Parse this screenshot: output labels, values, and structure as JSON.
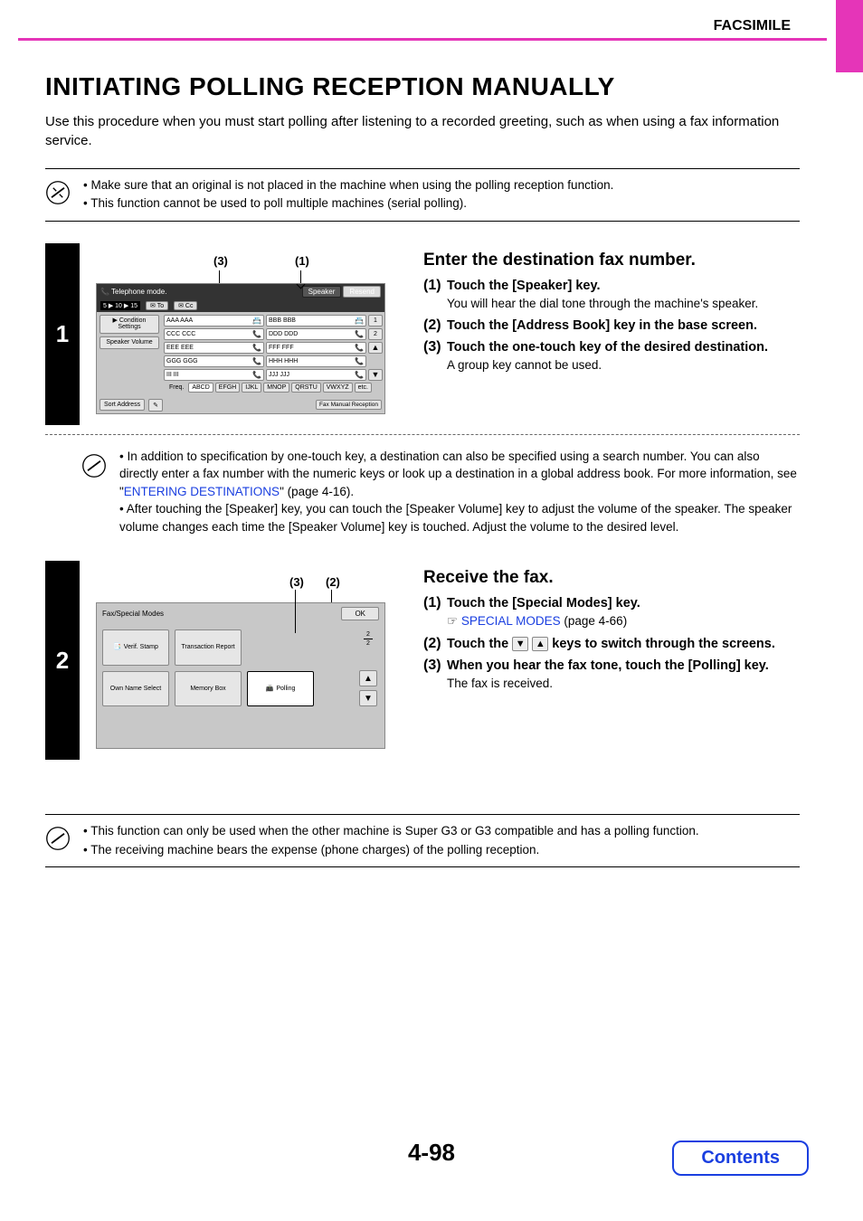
{
  "header": {
    "category": "FACSIMILE"
  },
  "title": "INITIATING POLLING RECEPTION MANUALLY",
  "intro": "Use this procedure when you must start polling after listening to a recorded greeting, such as when using a fax information service.",
  "top_notes": [
    "Make sure that an original is not placed in the machine when using the polling reception function.",
    "This function cannot be used to poll multiple machines (serial polling)."
  ],
  "step1": {
    "number": "1",
    "callouts": {
      "c3": "(3)",
      "c1": "(1)"
    },
    "heading": "Enter the destination fax number.",
    "items": [
      {
        "num": "(1)",
        "title": "Touch the [Speaker] key.",
        "body": "You will hear the dial tone through the machine's speaker."
      },
      {
        "num": "(2)",
        "title": "Touch the [Address Book] key in the base screen.",
        "body": ""
      },
      {
        "num": "(3)",
        "title": "Touch the one-touch key of the desired destination.",
        "body": "A group key cannot be used."
      }
    ],
    "panel": {
      "title": "Telephone mode.",
      "speaker": "Speaker",
      "resend": "Resend",
      "range": "5 ▶ 10 ▶ 15",
      "to": "To",
      "cc": "Cc",
      "left_buttons": {
        "cond": "Condition Settings",
        "vol": "Speaker Volume"
      },
      "addresses": [
        [
          "AAA AAA",
          "BBB BBB"
        ],
        [
          "CCC CCC",
          "DDD DDD"
        ],
        [
          "EEE EEE",
          "FFF FFF"
        ],
        [
          "GGG GGG",
          "HHH HHH"
        ],
        [
          "III III",
          "JJJ JJJ"
        ]
      ],
      "page_ind": [
        "1",
        "2"
      ],
      "freq": "Freq.",
      "tabs": [
        "ABCD",
        "EFGH",
        "IJKL",
        "MNOP",
        "QRSTU",
        "VWXYZ",
        "etc."
      ],
      "sort": "Sort Address",
      "fax_manual": "Fax Manual Reception"
    },
    "inner_notes": {
      "n1a": "In addition to specification by one-touch key, a destination can also be specified using a search number. You can also directly enter a fax number with the numeric keys or look up a destination in a global address book. For more information, see \"",
      "n1link": "ENTERING DESTINATIONS",
      "n1b": "\" (page 4-16).",
      "n2": "After touching the [Speaker] key, you can touch the [Speaker Volume] key to adjust the volume of the speaker. The speaker volume changes each time the [Speaker Volume] key is touched. Adjust the volume to the desired level."
    }
  },
  "step2": {
    "number": "2",
    "callouts": {
      "c3": "(3)",
      "c2": "(2)"
    },
    "heading": "Receive the fax.",
    "items": [
      {
        "num": "(1)",
        "title": "Touch the [Special Modes] key.",
        "linkpre": "☞ ",
        "link": "SPECIAL MODES",
        "linkpost": " (page 4-66)"
      },
      {
        "num": "(2)",
        "title_a": "Touch the ",
        "title_b": " keys to switch through the screens."
      },
      {
        "num": "(3)",
        "title": "When you hear the fax tone, touch the [Polling] key.",
        "body": "The fax is received."
      }
    ],
    "panel": {
      "title": "Fax/Special Modes",
      "ok": "OK",
      "modes": {
        "verif": "Verif. Stamp",
        "trans": "Transaction Report",
        "own": "Own Name Select",
        "mem": "Memory Box",
        "poll": "Polling"
      },
      "page_top": "2",
      "page_bot": "2"
    }
  },
  "bottom_notes": [
    "This function can only be used when the other machine is Super G3 or G3 compatible and has a polling function.",
    "The receiving machine bears the expense (phone charges) of the polling reception."
  ],
  "footer": {
    "page": "4-98",
    "contents": "Contents"
  }
}
